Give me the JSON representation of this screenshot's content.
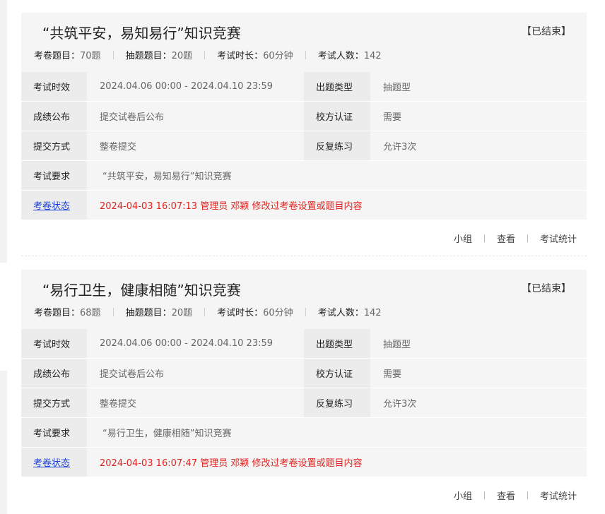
{
  "exams": [
    {
      "title": "“共筑平安，易知易行”知识竞赛",
      "status": "【已结束】",
      "stats": [
        {
          "label": "考卷题目：",
          "value": "70题"
        },
        {
          "label": "抽题题目：",
          "value": "20题"
        },
        {
          "label": "考试时长：",
          "value": "60分钟"
        },
        {
          "label": "考试人数：",
          "value": "142"
        }
      ],
      "rows": {
        "validity_label": "考试时效",
        "validity_value": "2024.04.06 00:00 - 2024.04.10 23:59",
        "qtype_label": "出题类型",
        "qtype_value": "抽题型",
        "publish_label": "成绩公布",
        "publish_value": "提交试卷后公布",
        "cert_label": "校方认证",
        "cert_value": "需要",
        "submit_label": "提交方式",
        "submit_value": "整卷提交",
        "repeat_label": "反复练习",
        "repeat_value": "允许3次",
        "req_label": "考试要求",
        "req_value": "“共筑平安，易知易行”知识竞赛",
        "state_label": "考卷状态",
        "state_value": "2024-04-03 16:07:13 管理员 邓颖 修改过考卷设置或题目内容"
      },
      "actions": {
        "group": "小组",
        "view": "查看",
        "stats": "考试统计"
      }
    },
    {
      "title": "“易行卫生，健康相随”知识竞赛",
      "status": "【已结束】",
      "stats": [
        {
          "label": "考卷题目：",
          "value": "68题"
        },
        {
          "label": "抽题题目：",
          "value": "20题"
        },
        {
          "label": "考试时长：",
          "value": "60分钟"
        },
        {
          "label": "考试人数：",
          "value": "142"
        }
      ],
      "rows": {
        "validity_label": "考试时效",
        "validity_value": "2024.04.06 00:00 - 2024.04.10 23:59",
        "qtype_label": "出题类型",
        "qtype_value": "抽题型",
        "publish_label": "成绩公布",
        "publish_value": "提交试卷后公布",
        "cert_label": "校方认证",
        "cert_value": "需要",
        "submit_label": "提交方式",
        "submit_value": "整卷提交",
        "repeat_label": "反复练习",
        "repeat_value": "允许3次",
        "req_label": "考试要求",
        "req_value": "“易行卫生，健康相随”知识竞赛",
        "state_label": "考卷状态",
        "state_value": "2024-04-03 16:07:47 管理员 邓颖 修改过考卷设置或题目内容"
      },
      "actions": {
        "group": "小组",
        "view": "查看",
        "stats": "考试统计"
      }
    }
  ]
}
